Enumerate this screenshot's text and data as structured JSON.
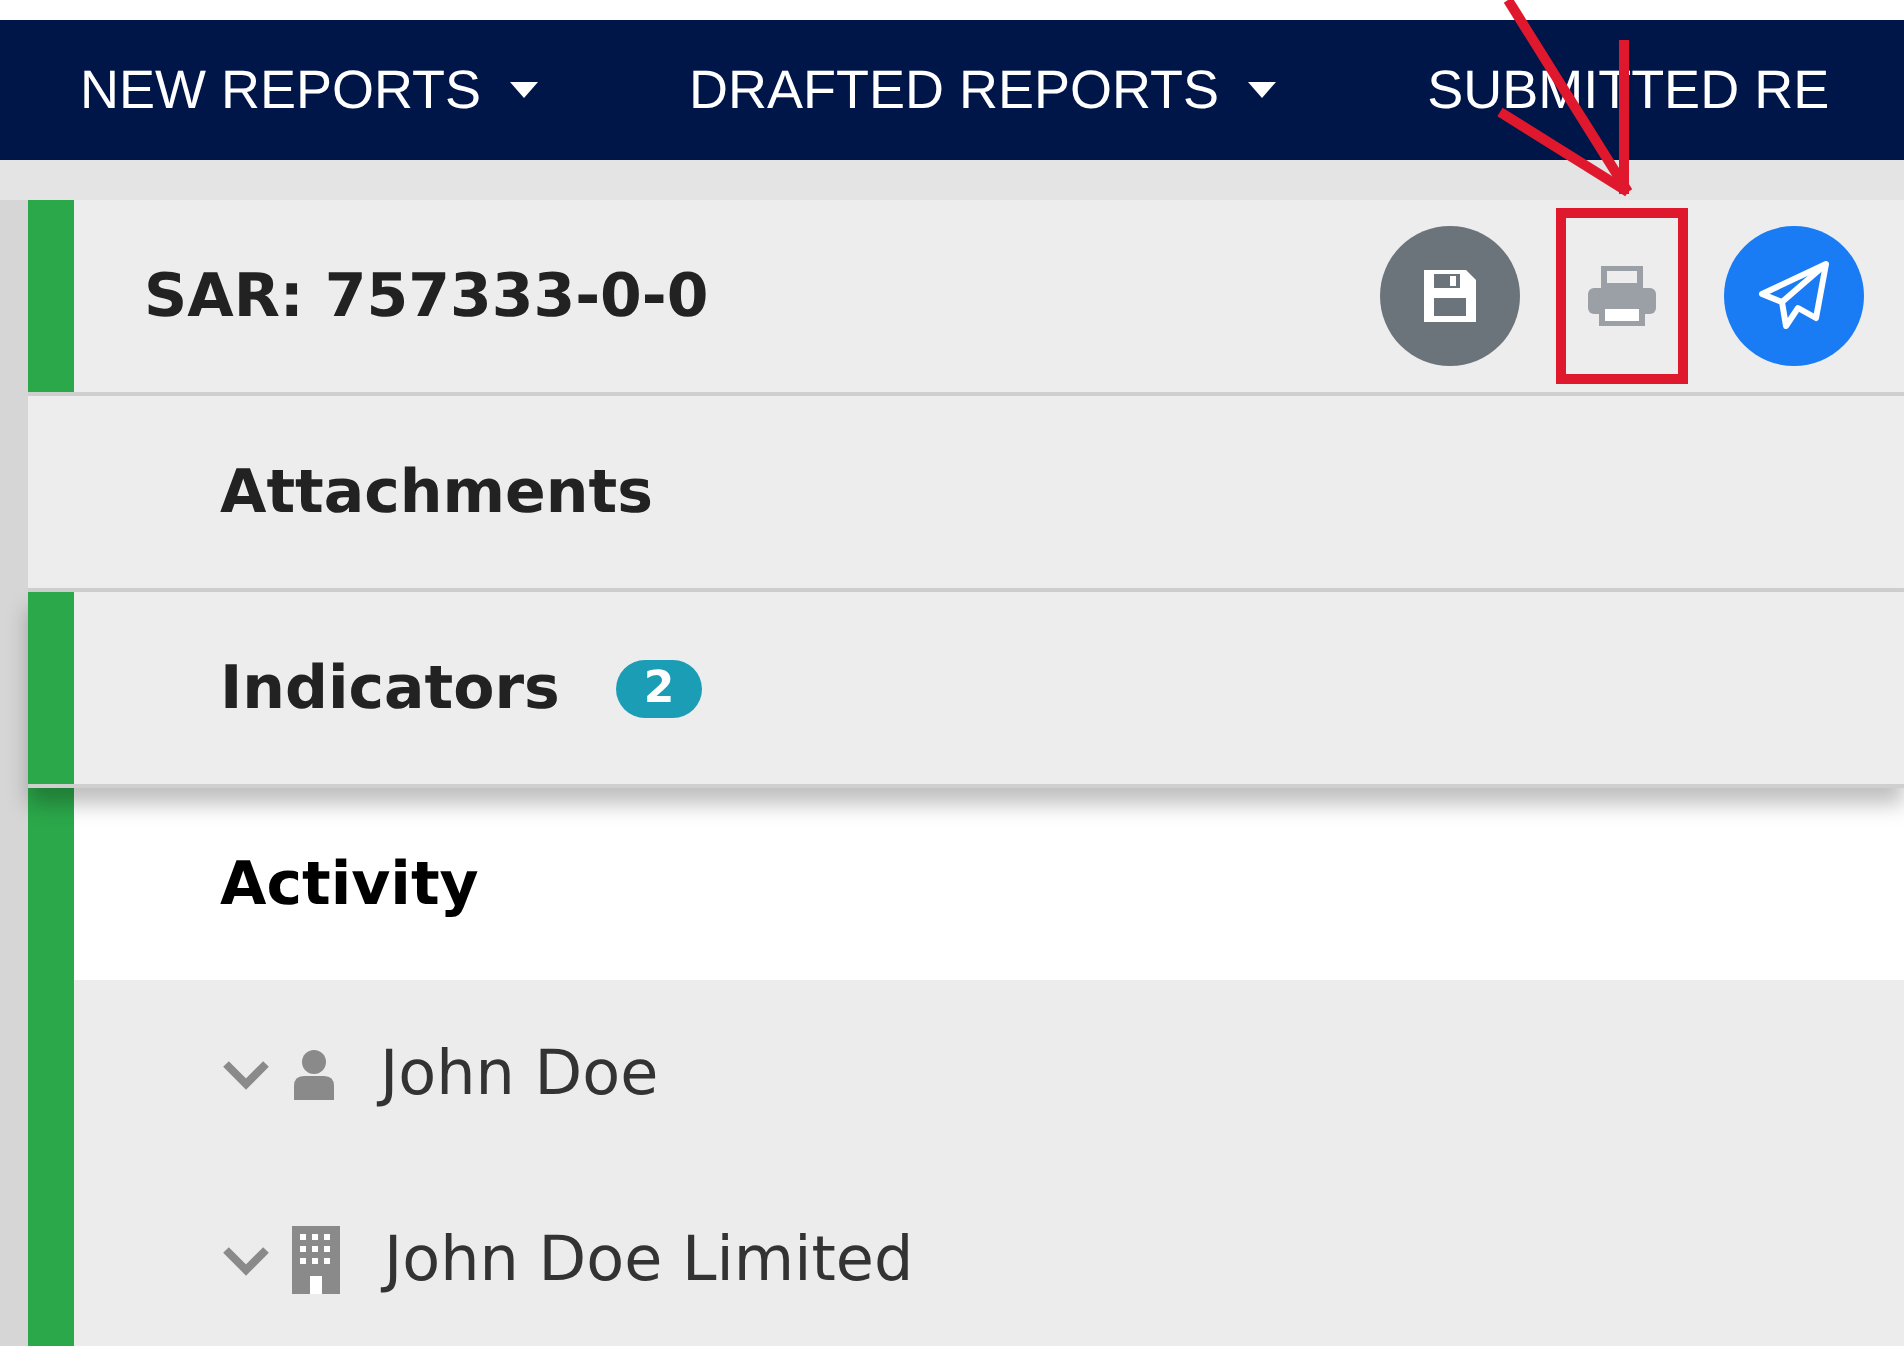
{
  "nav": [
    {
      "label": "NEW REPORTS",
      "caret": true
    },
    {
      "label": "DRAFTED REPORTS",
      "caret": true
    },
    {
      "label": "SUBMITTED RE",
      "caret": false
    }
  ],
  "report": {
    "title": "SAR: 757333-0-0",
    "actions": [
      {
        "kind": "save",
        "highlighted": false
      },
      {
        "kind": "print",
        "highlighted": true
      },
      {
        "kind": "send",
        "highlighted": false
      }
    ]
  },
  "sections": [
    {
      "label": "Attachments",
      "accent": false,
      "selected": false
    },
    {
      "label": "Indicators",
      "accent": true,
      "selected": false,
      "badge": "2"
    },
    {
      "label": "Activity",
      "accent": true,
      "selected": true
    }
  ],
  "parties": [
    {
      "name": "John Doe",
      "kind": "person"
    },
    {
      "name": "John Doe Limited",
      "kind": "organization"
    }
  ]
}
